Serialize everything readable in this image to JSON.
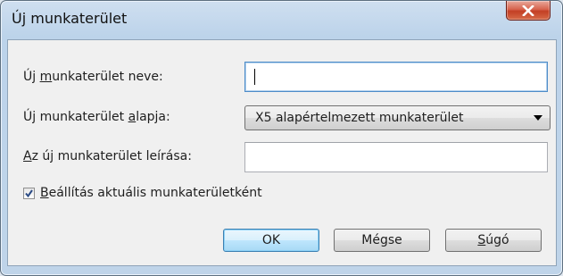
{
  "window": {
    "title": "Új munkaterület"
  },
  "form": {
    "name_label_pre": "Új ",
    "name_label_ul": "m",
    "name_label_post": "unkaterület neve:",
    "name_value": "",
    "base_label_pre": "Új munkaterület ",
    "base_label_ul": "a",
    "base_label_post": "lapja:",
    "base_value": "X5 alapértelmezett munkaterület",
    "desc_label_pre": "",
    "desc_label_ul": "A",
    "desc_label_post": "z új munkaterület leírása:",
    "desc_value": "",
    "set_current_pre": "",
    "set_current_ul": "B",
    "set_current_post": "eállítás aktuális munkaterületként",
    "set_current_checked": true
  },
  "buttons": {
    "ok": "OK",
    "cancel": "Mégse",
    "help_pre": "",
    "help_ul": "S",
    "help_post": "úgó"
  },
  "icons": {
    "close": "close-icon",
    "check": "checkmark-icon",
    "dropdown": "chevron-down-icon"
  }
}
